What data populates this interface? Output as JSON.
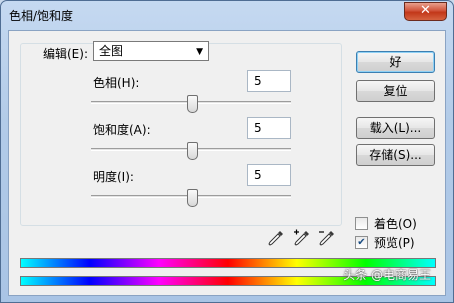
{
  "window": {
    "title": "色相/饱和度",
    "close_glyph": "✕"
  },
  "edit": {
    "label": "编辑(E):",
    "selected": "全图",
    "dropdown_arrow": "▼"
  },
  "rows": [
    {
      "label": "色相(H):",
      "value": "5",
      "slider_fraction": 0.51
    },
    {
      "label": "饱和度(A):",
      "value": "5",
      "slider_fraction": 0.51
    },
    {
      "label": "明度(I):",
      "value": "5",
      "slider_fraction": 0.51
    }
  ],
  "buttons": {
    "ok": "好",
    "reset": "复位",
    "load": "载入(L)...",
    "save": "存储(S)..."
  },
  "checkboxes": {
    "colorize": {
      "label": "着色(O)",
      "checked": false
    },
    "preview": {
      "label": "预览(P)",
      "checked": true,
      "check_glyph": "✔"
    }
  },
  "icons": [
    "eyedropper-icon",
    "eyedropper-plus-icon",
    "eyedropper-minus-icon"
  ],
  "watermark": "头条 @电商易王",
  "colors": {
    "title_bar": "#b2cbe8",
    "close_button": "#c23719",
    "client_bg": "#f0f0f0",
    "default_button_border": "#3c7fb1"
  }
}
